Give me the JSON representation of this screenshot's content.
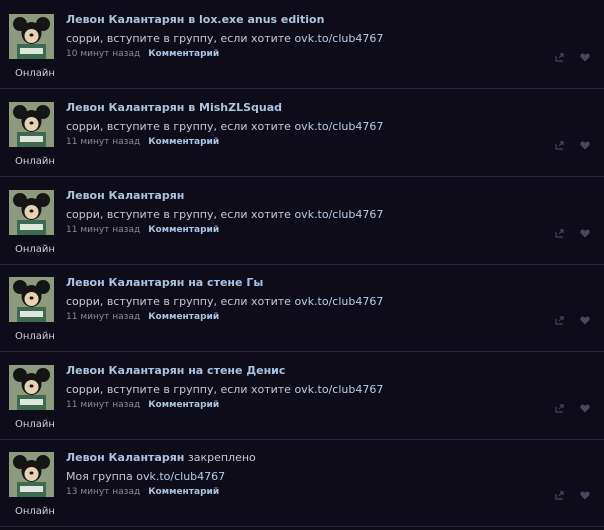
{
  "posts": [
    {
      "author": "Левон Калантарян",
      "connector": "в",
      "target": "lox.exe anus edition",
      "text": "сорри, вступите в группу, если хотите ",
      "link": "ovk.to/club4767",
      "time": "10 минут назад",
      "comment": "Комментарий",
      "status": "Онлайн",
      "pinned_label": ""
    },
    {
      "author": "Левон Калантарян",
      "connector": "в",
      "target": "MishZLSquad",
      "text": "сорри, вступите в группу, если хотите ",
      "link": "ovk.to/club4767",
      "time": "11 минут назад",
      "comment": "Комментарий",
      "status": "Онлайн",
      "pinned_label": ""
    },
    {
      "author": "Левон Калантарян",
      "connector": "",
      "target": "",
      "text": "сорри, вступите в группу, если хотите ",
      "link": "ovk.to/club4767",
      "time": "11 минут назад",
      "comment": "Комментарий",
      "status": "Онлайн",
      "pinned_label": ""
    },
    {
      "author": "Левон Калантарян",
      "connector": "на стене",
      "target": "Гы",
      "text": "сорри, вступите в группу, если хотите ",
      "link": "ovk.to/club4767",
      "time": "11 минут назад",
      "comment": "Комментарий",
      "status": "Онлайн",
      "pinned_label": ""
    },
    {
      "author": "Левон Калантарян",
      "connector": "на стене",
      "target": "Денис",
      "text": "сорри, вступите в группу, если хотите ",
      "link": "ovk.to/club4767",
      "time": "11 минут назад",
      "comment": "Комментарий",
      "status": "Онлайн",
      "pinned_label": ""
    },
    {
      "author": "Левон Калантарян",
      "connector": "",
      "target": "",
      "text": "Моя группа ",
      "link": "ovk.to/club4767",
      "time": "13 минут назад",
      "comment": "Комментарий",
      "status": "Онлайн",
      "pinned_label": "закреплено"
    }
  ],
  "icons": {
    "share": "share-icon",
    "like": "heart-icon"
  },
  "colors": {
    "background": "#0f0c1a",
    "link": "#a9c4e3",
    "separator": "#2a2638"
  }
}
